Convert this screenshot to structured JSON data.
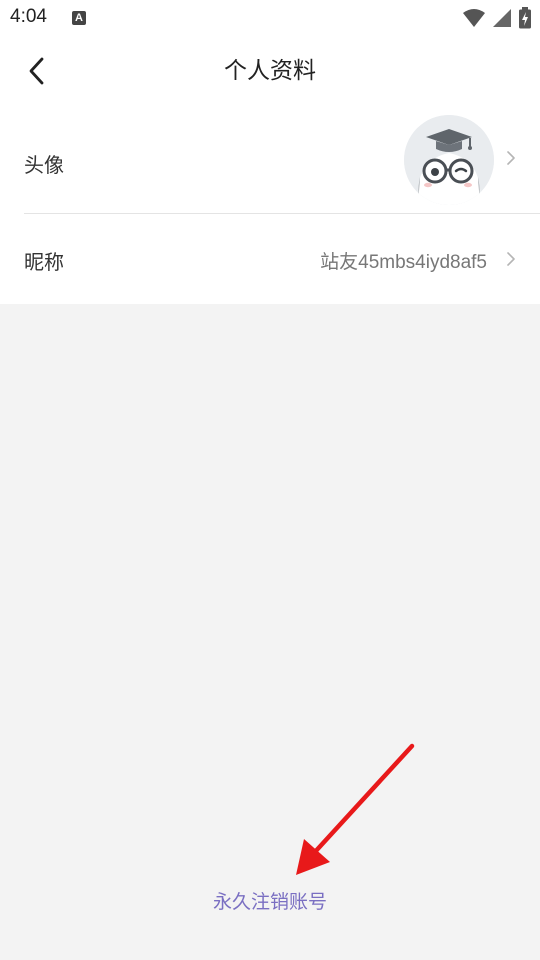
{
  "status_bar": {
    "time": "4:04",
    "notification_icon_letter": "A",
    "icons": [
      "wifi-icon",
      "signal-icon",
      "battery-icon"
    ]
  },
  "header": {
    "title": "个人资料",
    "back_icon": "chevron-left-icon"
  },
  "rows": {
    "avatar": {
      "label": "头像",
      "image": "cartoon-avatar-with-graduation-cap-and-glasses"
    },
    "nickname": {
      "label": "昵称",
      "value": "站友45mbs4iyd8af5"
    }
  },
  "footer": {
    "delete_account_label": "永久注销账号"
  },
  "annotation": {
    "arrow_color": "#e8191a"
  },
  "colors": {
    "background": "#f3f3f3",
    "card": "#ffffff",
    "link": "#7a6fc2"
  }
}
